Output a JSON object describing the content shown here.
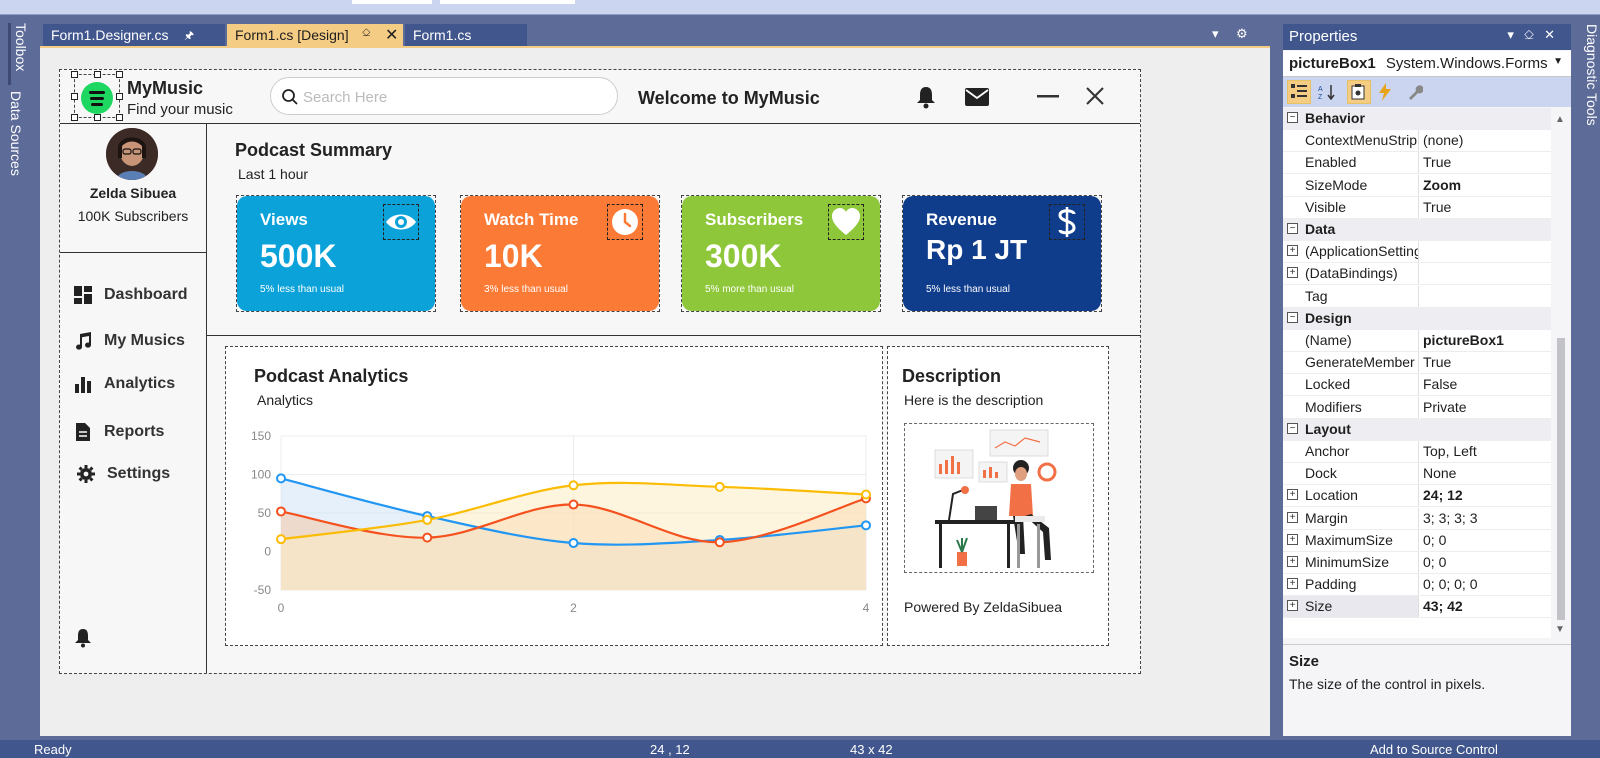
{
  "side_tabs": {
    "toolbox": "Toolbox",
    "data_sources": "Data Sources",
    "diagnostic": "Diagnostic Tools"
  },
  "tabs": [
    {
      "label": "Form1.Designer.cs"
    },
    {
      "label": "Form1.cs [Design]"
    },
    {
      "label": "Form1.cs"
    }
  ],
  "form": {
    "app_name": "MyMusic",
    "tagline": "Find your music",
    "search_placeholder": "Search Here",
    "welcome": "Welcome to MyMusic",
    "user": {
      "name": "Zelda Sibuea",
      "subscribers": "100K Subscribers"
    },
    "nav": [
      {
        "label": "Dashboard",
        "icon": "dashboard-icon"
      },
      {
        "label": "My Musics",
        "icon": "music-note-icon"
      },
      {
        "label": "Analytics",
        "icon": "bar-chart-icon"
      },
      {
        "label": "Reports",
        "icon": "document-icon"
      },
      {
        "label": "Settings",
        "icon": "gear-icon"
      }
    ],
    "summary": {
      "title": "Podcast Summary",
      "subtitle": "Last 1 hour",
      "cards": [
        {
          "title": "Views",
          "value": "500K",
          "note": "5% less than usual",
          "icon": "eye-icon",
          "color": "#0aa2d8"
        },
        {
          "title": "Watch Time",
          "value": "10K",
          "note": "3% less than usual",
          "icon": "clock-icon",
          "color": "#fb7a36"
        },
        {
          "title": "Subscribers",
          "value": "300K",
          "note": "5% more than usual",
          "icon": "heart-icon",
          "color": "#8ec73a"
        },
        {
          "title": "Revenue",
          "value": "Rp 1 JT",
          "note": "5% less than usual",
          "icon": "dollar-icon",
          "color": "#0f3d8c"
        }
      ]
    },
    "analytics": {
      "title": "Podcast Analytics",
      "subtitle": "Analytics"
    },
    "description": {
      "title": "Description",
      "text": "Here is the description",
      "footer": "Powered By ZeldaSibuea"
    }
  },
  "chart_data": {
    "type": "area",
    "x": [
      0,
      1,
      2,
      3,
      4
    ],
    "xticks": [
      0,
      2,
      4
    ],
    "yticks": [
      150,
      100,
      50,
      0,
      -50
    ],
    "ylim": [
      -50,
      150
    ],
    "xlim": [
      0,
      4
    ],
    "grid": true,
    "series": [
      {
        "values": [
          95,
          46,
          11,
          15,
          34
        ],
        "color": "#2196f3",
        "fill": "#cfe3f5"
      },
      {
        "values": [
          52,
          18,
          61,
          12,
          69
        ],
        "color": "#f4511e",
        "fill": "#f5c8a8"
      },
      {
        "values": [
          16,
          41,
          86,
          84,
          74
        ],
        "color": "#fbbc05",
        "fill": "#fdecc4"
      }
    ]
  },
  "properties": {
    "header": "Properties",
    "object_name": "pictureBox1",
    "object_type": "System.Windows.Forms",
    "rows": [
      {
        "kind": "cat",
        "label": "Behavior"
      },
      {
        "kind": "prop",
        "name": "ContextMenuStrip",
        "value": "(none)"
      },
      {
        "kind": "prop",
        "name": "Enabled",
        "value": "True"
      },
      {
        "kind": "prop",
        "name": "SizeMode",
        "value": "Zoom",
        "bold": true
      },
      {
        "kind": "prop",
        "name": "Visible",
        "value": "True"
      },
      {
        "kind": "cat",
        "label": "Data"
      },
      {
        "kind": "prop",
        "name": "(ApplicationSettings)",
        "value": "",
        "expand": true
      },
      {
        "kind": "prop",
        "name": "(DataBindings)",
        "value": "",
        "expand": true
      },
      {
        "kind": "prop",
        "name": "Tag",
        "value": ""
      },
      {
        "kind": "cat",
        "label": "Design"
      },
      {
        "kind": "prop",
        "name": "(Name)",
        "value": "pictureBox1",
        "bold": true
      },
      {
        "kind": "prop",
        "name": "GenerateMember",
        "value": "True"
      },
      {
        "kind": "prop",
        "name": "Locked",
        "value": "False"
      },
      {
        "kind": "prop",
        "name": "Modifiers",
        "value": "Private"
      },
      {
        "kind": "cat",
        "label": "Layout"
      },
      {
        "kind": "prop",
        "name": "Anchor",
        "value": "Top, Left"
      },
      {
        "kind": "prop",
        "name": "Dock",
        "value": "None"
      },
      {
        "kind": "prop",
        "name": "Location",
        "value": "24; 12",
        "bold": true,
        "expand": true
      },
      {
        "kind": "prop",
        "name": "Margin",
        "value": "3; 3; 3; 3",
        "expand": true
      },
      {
        "kind": "prop",
        "name": "MaximumSize",
        "value": "0; 0",
        "expand": true
      },
      {
        "kind": "prop",
        "name": "MinimumSize",
        "value": "0; 0",
        "expand": true
      },
      {
        "kind": "prop",
        "name": "Padding",
        "value": "0; 0; 0; 0",
        "expand": true
      },
      {
        "kind": "prop",
        "name": "Size",
        "value": "43; 42",
        "bold": true,
        "expand": true,
        "selected": true
      }
    ],
    "desc_title": "Size",
    "desc_text": "The size of the control in pixels."
  },
  "status": {
    "left": "Ready",
    "pos": "24 , 12",
    "size": "43 x 42",
    "right": "Add to Source Control"
  }
}
